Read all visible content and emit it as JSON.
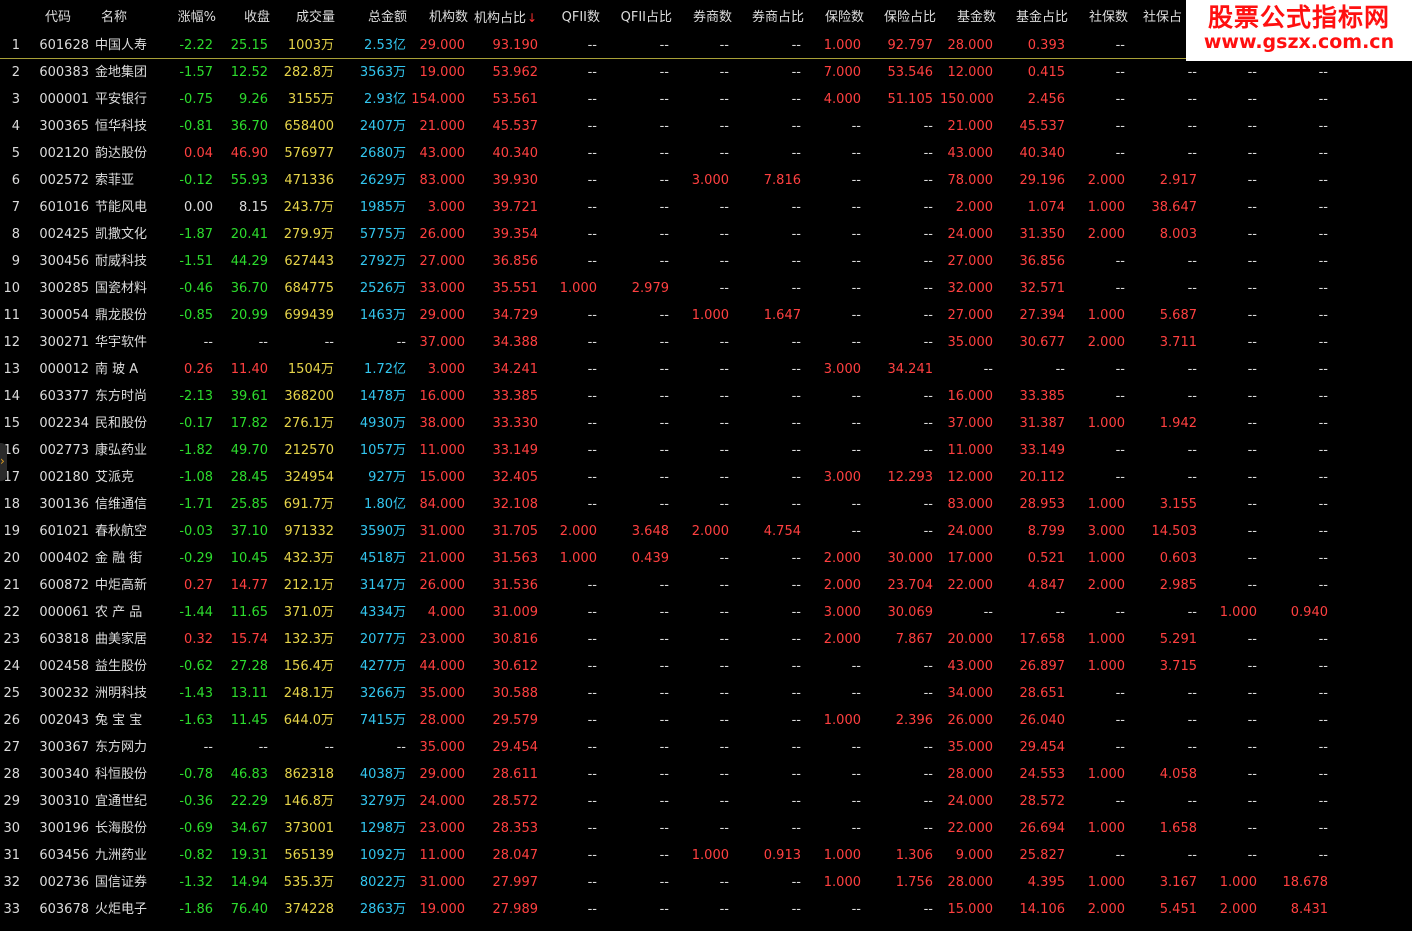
{
  "headers": {
    "code": "代码",
    "name": "名称",
    "change_pct": "涨幅%",
    "close": "收盘",
    "volume": "成交量",
    "amount": "总金额",
    "inst_count": "机构数",
    "inst_pct": "机构占比",
    "qfii_count": "QFII数",
    "qfii_pct": "QFII占比",
    "broker_count": "券商数",
    "broker_pct": "券商占比",
    "ins_count": "保险数",
    "ins_pct": "保险占比",
    "fund_count": "基金数",
    "fund_pct": "基金占比",
    "ss_count": "社保数",
    "ss_pct": "社保占"
  },
  "sort_indicator": "↓",
  "watermark": {
    "line1": "股票公式指标网",
    "line2": "www.gszx.com.cn"
  },
  "side_handle_icon": "›",
  "colors": {
    "up": "#ff4040",
    "down": "#2ddc2d",
    "volume": "#e6d44a",
    "amount": "#33c6ef"
  },
  "rows": [
    [
      "1",
      "601628",
      "中国人寿",
      "-2.22",
      "25.15",
      "1003万",
      "2.53亿",
      "29.000",
      "93.190",
      "--",
      "--",
      "--",
      "--",
      "1.000",
      "92.797",
      "28.000",
      "0.393",
      "--",
      "--",
      "--",
      "--"
    ],
    [
      "2",
      "600383",
      "金地集团",
      "-1.57",
      "12.52",
      "282.8万",
      "3563万",
      "19.000",
      "53.962",
      "--",
      "--",
      "--",
      "--",
      "7.000",
      "53.546",
      "12.000",
      "0.415",
      "--",
      "--",
      "--",
      "--"
    ],
    [
      "3",
      "000001",
      "平安银行",
      "-0.75",
      "9.26",
      "3155万",
      "2.93亿",
      "154.000",
      "53.561",
      "--",
      "--",
      "--",
      "--",
      "4.000",
      "51.105",
      "150.000",
      "2.456",
      "--",
      "--",
      "--",
      "--"
    ],
    [
      "4",
      "300365",
      "恒华科技",
      "-0.81",
      "36.70",
      "658400",
      "2407万",
      "21.000",
      "45.537",
      "--",
      "--",
      "--",
      "--",
      "--",
      "--",
      "21.000",
      "45.537",
      "--",
      "--",
      "--",
      "--"
    ],
    [
      "5",
      "002120",
      "韵达股份",
      "0.04",
      "46.90",
      "576977",
      "2680万",
      "43.000",
      "40.340",
      "--",
      "--",
      "--",
      "--",
      "--",
      "--",
      "43.000",
      "40.340",
      "--",
      "--",
      "--",
      "--"
    ],
    [
      "6",
      "002572",
      "索菲亚",
      "-0.12",
      "55.93",
      "471336",
      "2629万",
      "83.000",
      "39.930",
      "--",
      "--",
      "3.000",
      "7.816",
      "--",
      "--",
      "78.000",
      "29.196",
      "2.000",
      "2.917",
      "--",
      "--"
    ],
    [
      "7",
      "601016",
      "节能风电",
      "0.00",
      "8.15",
      "243.7万",
      "1985万",
      "3.000",
      "39.721",
      "--",
      "--",
      "--",
      "--",
      "--",
      "--",
      "2.000",
      "1.074",
      "1.000",
      "38.647",
      "--",
      "--"
    ],
    [
      "8",
      "002425",
      "凯撒文化",
      "-1.87",
      "20.41",
      "279.9万",
      "5775万",
      "26.000",
      "39.354",
      "--",
      "--",
      "--",
      "--",
      "--",
      "--",
      "24.000",
      "31.350",
      "2.000",
      "8.003",
      "--",
      "--"
    ],
    [
      "9",
      "300456",
      "耐威科技",
      "-1.51",
      "44.29",
      "627443",
      "2792万",
      "27.000",
      "36.856",
      "--",
      "--",
      "--",
      "--",
      "--",
      "--",
      "27.000",
      "36.856",
      "--",
      "--",
      "--",
      "--"
    ],
    [
      "10",
      "300285",
      "国瓷材料",
      "-0.46",
      "36.70",
      "684775",
      "2526万",
      "33.000",
      "35.551",
      "1.000",
      "2.979",
      "--",
      "--",
      "--",
      "--",
      "32.000",
      "32.571",
      "--",
      "--",
      "--",
      "--"
    ],
    [
      "11",
      "300054",
      "鼎龙股份",
      "-0.85",
      "20.99",
      "699439",
      "1463万",
      "29.000",
      "34.729",
      "--",
      "--",
      "1.000",
      "1.647",
      "--",
      "--",
      "27.000",
      "27.394",
      "1.000",
      "5.687",
      "--",
      "--"
    ],
    [
      "12",
      "300271",
      "华宇软件",
      "--",
      "--",
      "--",
      "--",
      "37.000",
      "34.388",
      "--",
      "--",
      "--",
      "--",
      "--",
      "--",
      "35.000",
      "30.677",
      "2.000",
      "3.711",
      "--",
      "--"
    ],
    [
      "13",
      "000012",
      "南 玻 A",
      "0.26",
      "11.40",
      "1504万",
      "1.72亿",
      "3.000",
      "34.241",
      "--",
      "--",
      "--",
      "--",
      "3.000",
      "34.241",
      "--",
      "--",
      "--",
      "--",
      "--",
      "--"
    ],
    [
      "14",
      "603377",
      "东方时尚",
      "-2.13",
      "39.61",
      "368200",
      "1478万",
      "16.000",
      "33.385",
      "--",
      "--",
      "--",
      "--",
      "--",
      "--",
      "16.000",
      "33.385",
      "--",
      "--",
      "--",
      "--"
    ],
    [
      "15",
      "002234",
      "民和股份",
      "-0.17",
      "17.82",
      "276.1万",
      "4930万",
      "38.000",
      "33.330",
      "--",
      "--",
      "--",
      "--",
      "--",
      "--",
      "37.000",
      "31.387",
      "1.000",
      "1.942",
      "--",
      "--"
    ],
    [
      "16",
      "002773",
      "康弘药业",
      "-1.82",
      "49.70",
      "212570",
      "1057万",
      "11.000",
      "33.149",
      "--",
      "--",
      "--",
      "--",
      "--",
      "--",
      "11.000",
      "33.149",
      "--",
      "--",
      "--",
      "--"
    ],
    [
      "17",
      "002180",
      "艾派克",
      "-1.08",
      "28.45",
      "324954",
      "927万",
      "15.000",
      "32.405",
      "--",
      "--",
      "--",
      "--",
      "3.000",
      "12.293",
      "12.000",
      "20.112",
      "--",
      "--",
      "--",
      "--"
    ],
    [
      "18",
      "300136",
      "信维通信",
      "-1.71",
      "25.85",
      "691.7万",
      "1.80亿",
      "84.000",
      "32.108",
      "--",
      "--",
      "--",
      "--",
      "--",
      "--",
      "83.000",
      "28.953",
      "1.000",
      "3.155",
      "--",
      "--"
    ],
    [
      "19",
      "601021",
      "春秋航空",
      "-0.03",
      "37.10",
      "971332",
      "3590万",
      "31.000",
      "31.705",
      "2.000",
      "3.648",
      "2.000",
      "4.754",
      "--",
      "--",
      "24.000",
      "8.799",
      "3.000",
      "14.503",
      "--",
      "--"
    ],
    [
      "20",
      "000402",
      "金 融 街",
      "-0.29",
      "10.45",
      "432.3万",
      "4518万",
      "21.000",
      "31.563",
      "1.000",
      "0.439",
      "--",
      "--",
      "2.000",
      "30.000",
      "17.000",
      "0.521",
      "1.000",
      "0.603",
      "--",
      "--"
    ],
    [
      "21",
      "600872",
      "中炬高新",
      "0.27",
      "14.77",
      "212.1万",
      "3147万",
      "26.000",
      "31.536",
      "--",
      "--",
      "--",
      "--",
      "2.000",
      "23.704",
      "22.000",
      "4.847",
      "2.000",
      "2.985",
      "--",
      "--"
    ],
    [
      "22",
      "000061",
      "农 产 品",
      "-1.44",
      "11.65",
      "371.0万",
      "4334万",
      "4.000",
      "31.009",
      "--",
      "--",
      "--",
      "--",
      "3.000",
      "30.069",
      "--",
      "--",
      "--",
      "--",
      "1.000",
      "0.940"
    ],
    [
      "23",
      "603818",
      "曲美家居",
      "0.32",
      "15.74",
      "132.3万",
      "2077万",
      "23.000",
      "30.816",
      "--",
      "--",
      "--",
      "--",
      "2.000",
      "7.867",
      "20.000",
      "17.658",
      "1.000",
      "5.291",
      "--",
      "--"
    ],
    [
      "24",
      "002458",
      "益生股份",
      "-0.62",
      "27.28",
      "156.4万",
      "4277万",
      "44.000",
      "30.612",
      "--",
      "--",
      "--",
      "--",
      "--",
      "--",
      "43.000",
      "26.897",
      "1.000",
      "3.715",
      "--",
      "--"
    ],
    [
      "25",
      "300232",
      "洲明科技",
      "-1.43",
      "13.11",
      "248.1万",
      "3266万",
      "35.000",
      "30.588",
      "--",
      "--",
      "--",
      "--",
      "--",
      "--",
      "34.000",
      "28.651",
      "--",
      "--",
      "--",
      "--"
    ],
    [
      "26",
      "002043",
      "兔 宝 宝",
      "-1.63",
      "11.45",
      "644.0万",
      "7415万",
      "28.000",
      "29.579",
      "--",
      "--",
      "--",
      "--",
      "1.000",
      "2.396",
      "26.000",
      "26.040",
      "--",
      "--",
      "--",
      "--"
    ],
    [
      "27",
      "300367",
      "东方网力",
      "--",
      "--",
      "--",
      "--",
      "35.000",
      "29.454",
      "--",
      "--",
      "--",
      "--",
      "--",
      "--",
      "35.000",
      "29.454",
      "--",
      "--",
      "--",
      "--"
    ],
    [
      "28",
      "300340",
      "科恒股份",
      "-0.78",
      "46.83",
      "862318",
      "4038万",
      "29.000",
      "28.611",
      "--",
      "--",
      "--",
      "--",
      "--",
      "--",
      "28.000",
      "24.553",
      "1.000",
      "4.058",
      "--",
      "--"
    ],
    [
      "29",
      "300310",
      "宜通世纪",
      "-0.36",
      "22.29",
      "146.8万",
      "3279万",
      "24.000",
      "28.572",
      "--",
      "--",
      "--",
      "--",
      "--",
      "--",
      "24.000",
      "28.572",
      "--",
      "--",
      "--",
      "--"
    ],
    [
      "30",
      "300196",
      "长海股份",
      "-0.69",
      "34.67",
      "373001",
      "1298万",
      "23.000",
      "28.353",
      "--",
      "--",
      "--",
      "--",
      "--",
      "--",
      "22.000",
      "26.694",
      "1.000",
      "1.658",
      "--",
      "--"
    ],
    [
      "31",
      "603456",
      "九洲药业",
      "-0.82",
      "19.31",
      "565139",
      "1092万",
      "11.000",
      "28.047",
      "--",
      "--",
      "1.000",
      "0.913",
      "1.000",
      "1.306",
      "9.000",
      "25.827",
      "--",
      "--",
      "--",
      "--"
    ],
    [
      "32",
      "002736",
      "国信证券",
      "-1.32",
      "14.94",
      "535.3万",
      "8022万",
      "31.000",
      "27.997",
      "--",
      "--",
      "--",
      "--",
      "1.000",
      "1.756",
      "28.000",
      "4.395",
      "1.000",
      "3.167",
      "1.000",
      "18.678"
    ],
    [
      "33",
      "603678",
      "火炬电子",
      "-1.86",
      "76.40",
      "374228",
      "2863万",
      "19.000",
      "27.989",
      "--",
      "--",
      "--",
      "--",
      "--",
      "--",
      "15.000",
      "14.106",
      "2.000",
      "5.451",
      "2.000",
      "8.431"
    ]
  ]
}
